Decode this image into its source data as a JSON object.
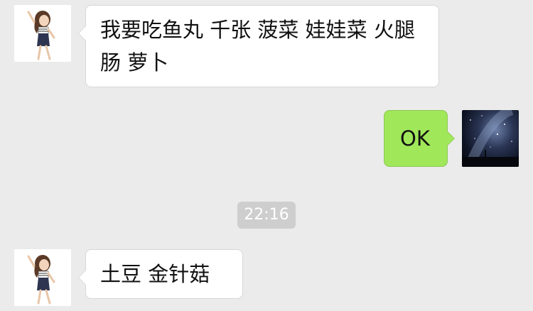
{
  "messages": [
    {
      "sender": "contact",
      "avatar": "girl-cartoon-avatar",
      "text": "我要吃鱼丸 千张 菠菜 娃娃菜 火腿肠 萝卜"
    },
    {
      "sender": "me",
      "avatar": "starry-sky-avatar",
      "text": "OK"
    },
    {
      "sender": "contact",
      "avatar": "girl-cartoon-avatar",
      "text": "土豆 金针菇"
    }
  ],
  "timestamp": "22:16",
  "colors": {
    "background": "#ebebeb",
    "incoming_bubble": "#ffffff",
    "outgoing_bubble": "#a0e75a",
    "timestamp_pill": "#cecece"
  }
}
